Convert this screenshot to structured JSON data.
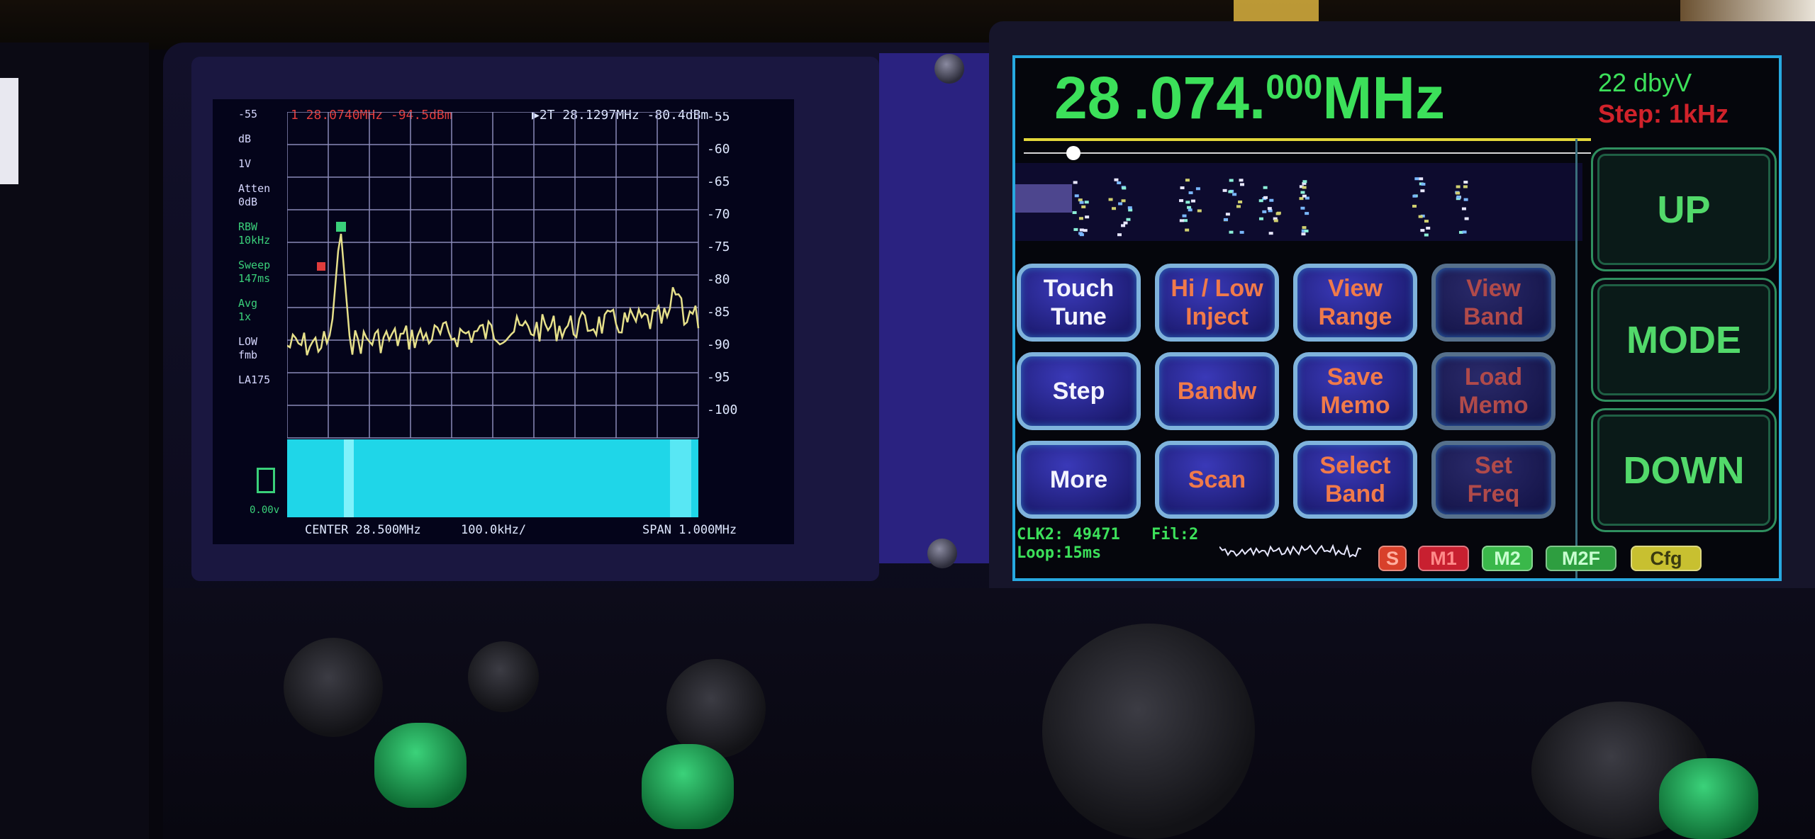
{
  "spectrum": {
    "marker1": "1  28.0740MHz  -94.5dBm",
    "marker2": "▶2T  28.1297MHz  -80.4dBm",
    "side_labels": [
      "-55",
      "dB",
      "1V",
      "Atten\n0dB",
      "RBW\n10kHz",
      "Sweep\n147ms",
      "Avg\n1x",
      "LOW\nfmb",
      "LA175"
    ],
    "y_ticks": [
      "-55",
      "-60",
      "-65",
      "-70",
      "-75",
      "-80",
      "-85",
      "-90",
      "-95",
      "-100"
    ],
    "footer_center": "CENTER 28.500MHz",
    "footer_scale": "100.0kHz/",
    "footer_span": "SPAN 1.000MHz",
    "battery_voltage": "0.00v"
  },
  "receiver": {
    "freq_mhz": "28",
    "freq_khz": ".074.",
    "freq_hz": "000",
    "freq_unit": "MHz",
    "signal": "22 dbyV",
    "step_info": "Step: 1kHz",
    "buttons": [
      {
        "label": "Touch\nTune",
        "style": "white"
      },
      {
        "label": "Hi / Low\nInject",
        "style": "orange"
      },
      {
        "label": "View\nRange",
        "style": "orange"
      },
      {
        "label": "View\nBand",
        "style": "dim"
      },
      {
        "label": "Step",
        "style": "white"
      },
      {
        "label": "Bandw",
        "style": "orange"
      },
      {
        "label": "Save\nMemo",
        "style": "orange"
      },
      {
        "label": "Load\nMemo",
        "style": "dim"
      },
      {
        "label": "More",
        "style": "white"
      },
      {
        "label": "Scan",
        "style": "orange"
      },
      {
        "label": "Select\nBand",
        "style": "orange"
      },
      {
        "label": "Set\nFreq",
        "style": "dim"
      }
    ],
    "side_buttons": {
      "up": "UP",
      "mode": "MODE",
      "down": "DOWN"
    },
    "status": {
      "clk": "CLK2: 49471",
      "filter": "Fil:2",
      "loop": "Loop:15ms",
      "badges": [
        {
          "label": "S",
          "bg": "#d8402a",
          "fg": "#ffb0a0"
        },
        {
          "label": "M1",
          "bg": "#c82030",
          "fg": "#ff8a8a"
        },
        {
          "label": "M2",
          "bg": "#3ab84a",
          "fg": "#c8ffd0"
        },
        {
          "label": "M2F",
          "bg": "#2e9e40",
          "fg": "#c8ffd0"
        },
        {
          "label": "Cfg",
          "bg": "#c8c030",
          "fg": "#3a3a10"
        }
      ]
    }
  },
  "colors": {
    "lcd_green": "#3ce05a",
    "trace_yellow": "#e6e08a",
    "grid": "#8a8ab8",
    "waterfall_cyan": "#1fd6e8",
    "button_border": "#7fb3dc"
  }
}
